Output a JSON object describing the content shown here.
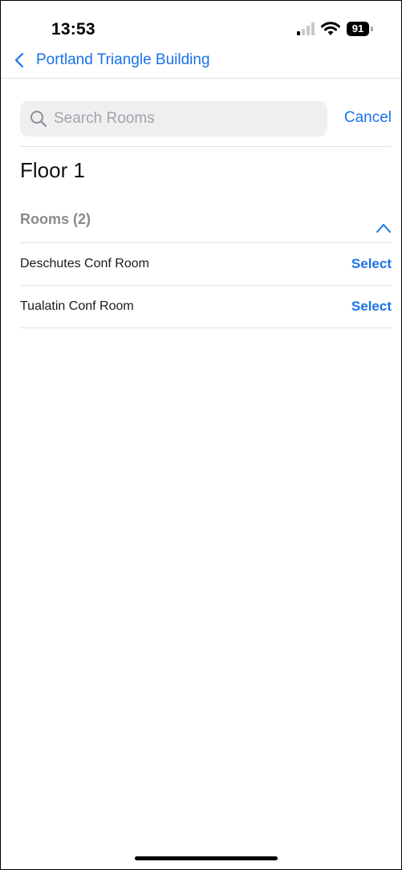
{
  "status_bar": {
    "time": "13:53",
    "battery_level": "91",
    "icons": [
      "cellular-signal-icon",
      "wifi-icon",
      "battery-icon"
    ]
  },
  "nav": {
    "back_label": "Portland Triangle Building",
    "back_icon": "chevron-left-icon"
  },
  "search": {
    "placeholder": "Search Rooms",
    "value": "",
    "cancel_label": "Cancel",
    "icon": "search-icon"
  },
  "floor": {
    "title": "Floor 1"
  },
  "rooms_section": {
    "title": "Rooms (2)",
    "collapse_icon": "chevron-up-icon",
    "items": [
      {
        "name": "Deschutes Conf Room",
        "action": "Select"
      },
      {
        "name": "Tualatin Conf Room",
        "action": "Select"
      }
    ]
  },
  "colors": {
    "accent": "#1a73e8",
    "section_header": "#8a8a8a",
    "search_bg": "#efeff1",
    "divider": "#e4e4e4"
  }
}
